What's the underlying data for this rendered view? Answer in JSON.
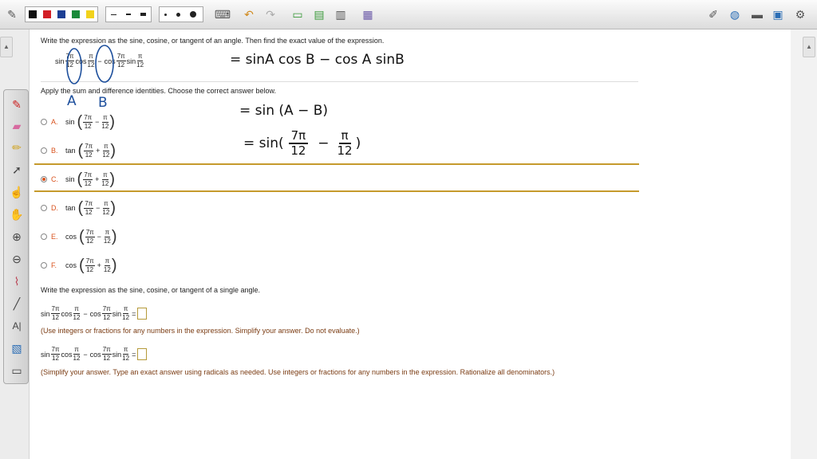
{
  "toolbar": {
    "colors": [
      "#111111",
      "#d21f26",
      "#1c3f94",
      "#1a8a3a",
      "#f2d21b"
    ]
  },
  "question1": {
    "instruction": "Write the expression as the sine, cosine, or tangent of an angle. Then find the exact value of the expression.",
    "expr": {
      "sin1": "sin",
      "cos1": "cos",
      "minus": "−",
      "cos2": "cos",
      "sin2": "sin",
      "num7pi": "7π",
      "den12": "12",
      "numpi": "π"
    },
    "apply": "Apply the sum and difference identities. Choose the correct answer below.",
    "options": [
      {
        "label": "A.",
        "fn": "sin",
        "op": "−",
        "selected": false
      },
      {
        "label": "B.",
        "fn": "tan",
        "op": "+",
        "selected": false
      },
      {
        "label": "C.",
        "fn": "sin",
        "op": "+",
        "selected": true
      },
      {
        "label": "D.",
        "fn": "tan",
        "op": "−",
        "selected": false
      },
      {
        "label": "E.",
        "fn": "cos",
        "op": "−",
        "selected": false
      },
      {
        "label": "F.",
        "fn": "cos",
        "op": "+",
        "selected": false
      }
    ]
  },
  "question2": {
    "instruction": "Write the expression as the sine, cosine, or tangent of a single angle.",
    "equals": "=",
    "hint1": "(Use integers or fractions for any numbers in the expression. Simplify your answer. Do not evaluate.)",
    "hint2": "(Simplify your answer. Type an exact answer using radicals as needed. Use integers or fractions for any numbers in the expression. Rationalize all denominators.)"
  },
  "handwriting": {
    "label_a": "A",
    "label_b": "B",
    "line1": "= sinA cos B − cos A sinB",
    "line2": "= sin (A − B)",
    "line3_prefix": "= sin(",
    "line3_num1": "7π",
    "line3_den1": "12",
    "line3_minus": "−",
    "line3_num2": "π",
    "line3_den2": "12",
    "line3_close": ")"
  }
}
